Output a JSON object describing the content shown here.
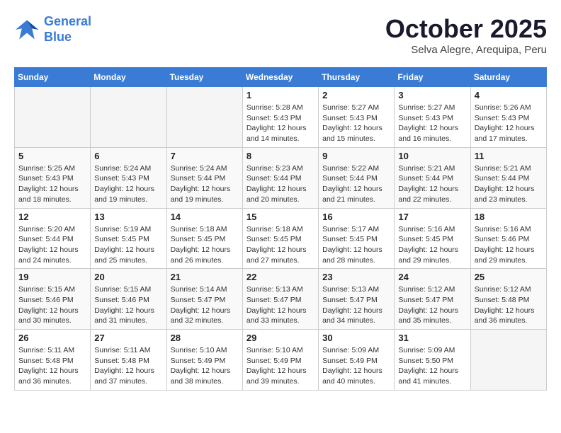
{
  "logo": {
    "line1": "General",
    "line2": "Blue"
  },
  "title": "October 2025",
  "subtitle": "Selva Alegre, Arequipa, Peru",
  "days_of_week": [
    "Sunday",
    "Monday",
    "Tuesday",
    "Wednesday",
    "Thursday",
    "Friday",
    "Saturday"
  ],
  "weeks": [
    {
      "days": [
        {
          "number": "",
          "info": ""
        },
        {
          "number": "",
          "info": ""
        },
        {
          "number": "",
          "info": ""
        },
        {
          "number": "1",
          "info": "Sunrise: 5:28 AM\nSunset: 5:43 PM\nDaylight: 12 hours\nand 14 minutes."
        },
        {
          "number": "2",
          "info": "Sunrise: 5:27 AM\nSunset: 5:43 PM\nDaylight: 12 hours\nand 15 minutes."
        },
        {
          "number": "3",
          "info": "Sunrise: 5:27 AM\nSunset: 5:43 PM\nDaylight: 12 hours\nand 16 minutes."
        },
        {
          "number": "4",
          "info": "Sunrise: 5:26 AM\nSunset: 5:43 PM\nDaylight: 12 hours\nand 17 minutes."
        }
      ]
    },
    {
      "days": [
        {
          "number": "5",
          "info": "Sunrise: 5:25 AM\nSunset: 5:43 PM\nDaylight: 12 hours\nand 18 minutes."
        },
        {
          "number": "6",
          "info": "Sunrise: 5:24 AM\nSunset: 5:43 PM\nDaylight: 12 hours\nand 19 minutes."
        },
        {
          "number": "7",
          "info": "Sunrise: 5:24 AM\nSunset: 5:44 PM\nDaylight: 12 hours\nand 19 minutes."
        },
        {
          "number": "8",
          "info": "Sunrise: 5:23 AM\nSunset: 5:44 PM\nDaylight: 12 hours\nand 20 minutes."
        },
        {
          "number": "9",
          "info": "Sunrise: 5:22 AM\nSunset: 5:44 PM\nDaylight: 12 hours\nand 21 minutes."
        },
        {
          "number": "10",
          "info": "Sunrise: 5:21 AM\nSunset: 5:44 PM\nDaylight: 12 hours\nand 22 minutes."
        },
        {
          "number": "11",
          "info": "Sunrise: 5:21 AM\nSunset: 5:44 PM\nDaylight: 12 hours\nand 23 minutes."
        }
      ]
    },
    {
      "days": [
        {
          "number": "12",
          "info": "Sunrise: 5:20 AM\nSunset: 5:44 PM\nDaylight: 12 hours\nand 24 minutes."
        },
        {
          "number": "13",
          "info": "Sunrise: 5:19 AM\nSunset: 5:45 PM\nDaylight: 12 hours\nand 25 minutes."
        },
        {
          "number": "14",
          "info": "Sunrise: 5:18 AM\nSunset: 5:45 PM\nDaylight: 12 hours\nand 26 minutes."
        },
        {
          "number": "15",
          "info": "Sunrise: 5:18 AM\nSunset: 5:45 PM\nDaylight: 12 hours\nand 27 minutes."
        },
        {
          "number": "16",
          "info": "Sunrise: 5:17 AM\nSunset: 5:45 PM\nDaylight: 12 hours\nand 28 minutes."
        },
        {
          "number": "17",
          "info": "Sunrise: 5:16 AM\nSunset: 5:45 PM\nDaylight: 12 hours\nand 29 minutes."
        },
        {
          "number": "18",
          "info": "Sunrise: 5:16 AM\nSunset: 5:46 PM\nDaylight: 12 hours\nand 29 minutes."
        }
      ]
    },
    {
      "days": [
        {
          "number": "19",
          "info": "Sunrise: 5:15 AM\nSunset: 5:46 PM\nDaylight: 12 hours\nand 30 minutes."
        },
        {
          "number": "20",
          "info": "Sunrise: 5:15 AM\nSunset: 5:46 PM\nDaylight: 12 hours\nand 31 minutes."
        },
        {
          "number": "21",
          "info": "Sunrise: 5:14 AM\nSunset: 5:47 PM\nDaylight: 12 hours\nand 32 minutes."
        },
        {
          "number": "22",
          "info": "Sunrise: 5:13 AM\nSunset: 5:47 PM\nDaylight: 12 hours\nand 33 minutes."
        },
        {
          "number": "23",
          "info": "Sunrise: 5:13 AM\nSunset: 5:47 PM\nDaylight: 12 hours\nand 34 minutes."
        },
        {
          "number": "24",
          "info": "Sunrise: 5:12 AM\nSunset: 5:47 PM\nDaylight: 12 hours\nand 35 minutes."
        },
        {
          "number": "25",
          "info": "Sunrise: 5:12 AM\nSunset: 5:48 PM\nDaylight: 12 hours\nand 36 minutes."
        }
      ]
    },
    {
      "days": [
        {
          "number": "26",
          "info": "Sunrise: 5:11 AM\nSunset: 5:48 PM\nDaylight: 12 hours\nand 36 minutes."
        },
        {
          "number": "27",
          "info": "Sunrise: 5:11 AM\nSunset: 5:48 PM\nDaylight: 12 hours\nand 37 minutes."
        },
        {
          "number": "28",
          "info": "Sunrise: 5:10 AM\nSunset: 5:49 PM\nDaylight: 12 hours\nand 38 minutes."
        },
        {
          "number": "29",
          "info": "Sunrise: 5:10 AM\nSunset: 5:49 PM\nDaylight: 12 hours\nand 39 minutes."
        },
        {
          "number": "30",
          "info": "Sunrise: 5:09 AM\nSunset: 5:49 PM\nDaylight: 12 hours\nand 40 minutes."
        },
        {
          "number": "31",
          "info": "Sunrise: 5:09 AM\nSunset: 5:50 PM\nDaylight: 12 hours\nand 41 minutes."
        },
        {
          "number": "",
          "info": ""
        }
      ]
    }
  ]
}
